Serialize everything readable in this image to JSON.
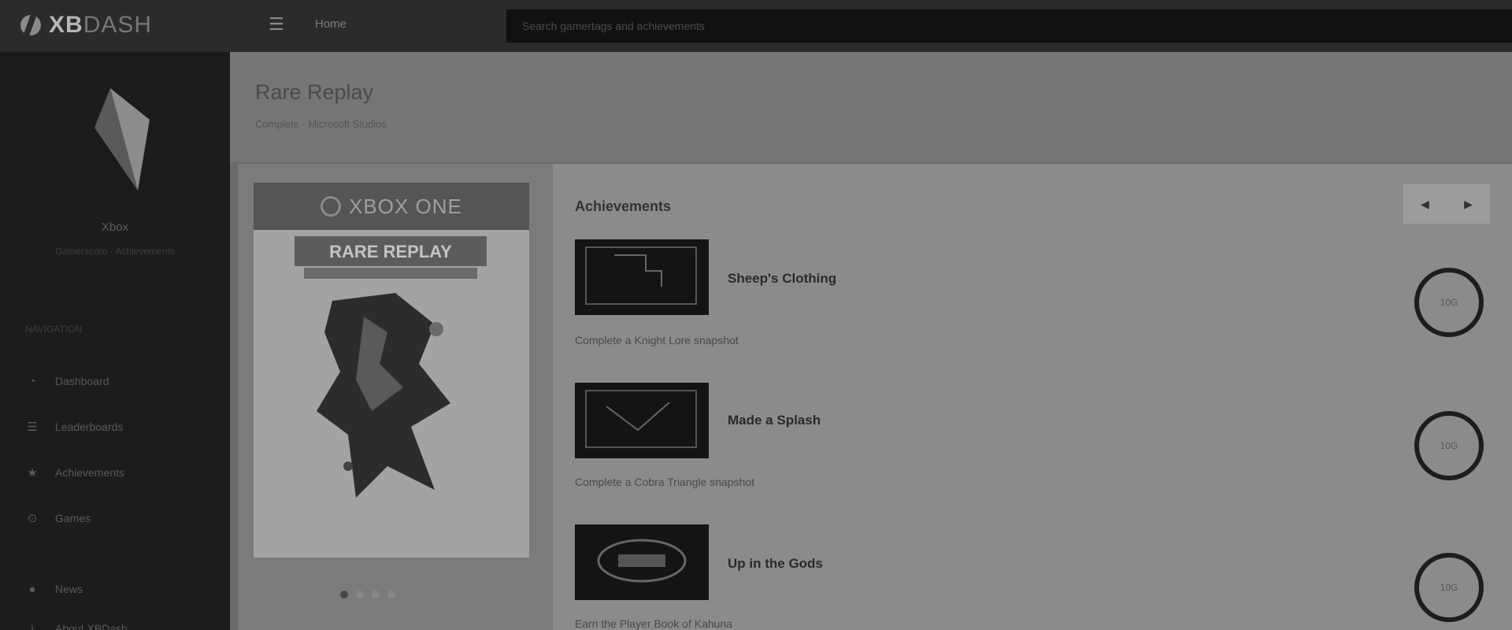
{
  "topbar": {
    "logo_bold": "XB",
    "logo_light": "DASH",
    "link_label": "Home",
    "search_placeholder": "Search gamertags and achievements"
  },
  "sidebar": {
    "profile_name": "Xbox",
    "profile_sub": "Gamerscore  ·  Achievements",
    "nav_heading": "NAVIGATION",
    "items": [
      {
        "label": "Dashboard",
        "icon": "dashboard-icon"
      },
      {
        "label": "Leaderboards",
        "icon": "leaderboard-icon"
      },
      {
        "label": "Achievements",
        "icon": "trophy-icon"
      },
      {
        "label": "Games",
        "icon": "gamepad-icon"
      },
      {
        "label": "News",
        "icon": "globe-icon"
      },
      {
        "label": "About XBDash",
        "icon": "info-icon"
      }
    ]
  },
  "page": {
    "title": "Rare Replay",
    "subtitle": "Complete · Microsoft Studios"
  },
  "achievements": {
    "heading": "Achievements",
    "sort_left": "◀",
    "sort_right": "▶",
    "items": [
      {
        "name": "Sheep's Clothing",
        "description": "Complete a Knight Lore snapshot",
        "badge": "10G"
      },
      {
        "name": "Made a Splash",
        "description": "Complete a Cobra Triangle snapshot",
        "badge": "10G"
      },
      {
        "name": "Up in the Gods",
        "description": "Earn the Player Book of Kahuna",
        "badge": "10G"
      }
    ]
  },
  "cover": {
    "platform": "XBOX ONE",
    "title": "RARE REPLAY"
  }
}
